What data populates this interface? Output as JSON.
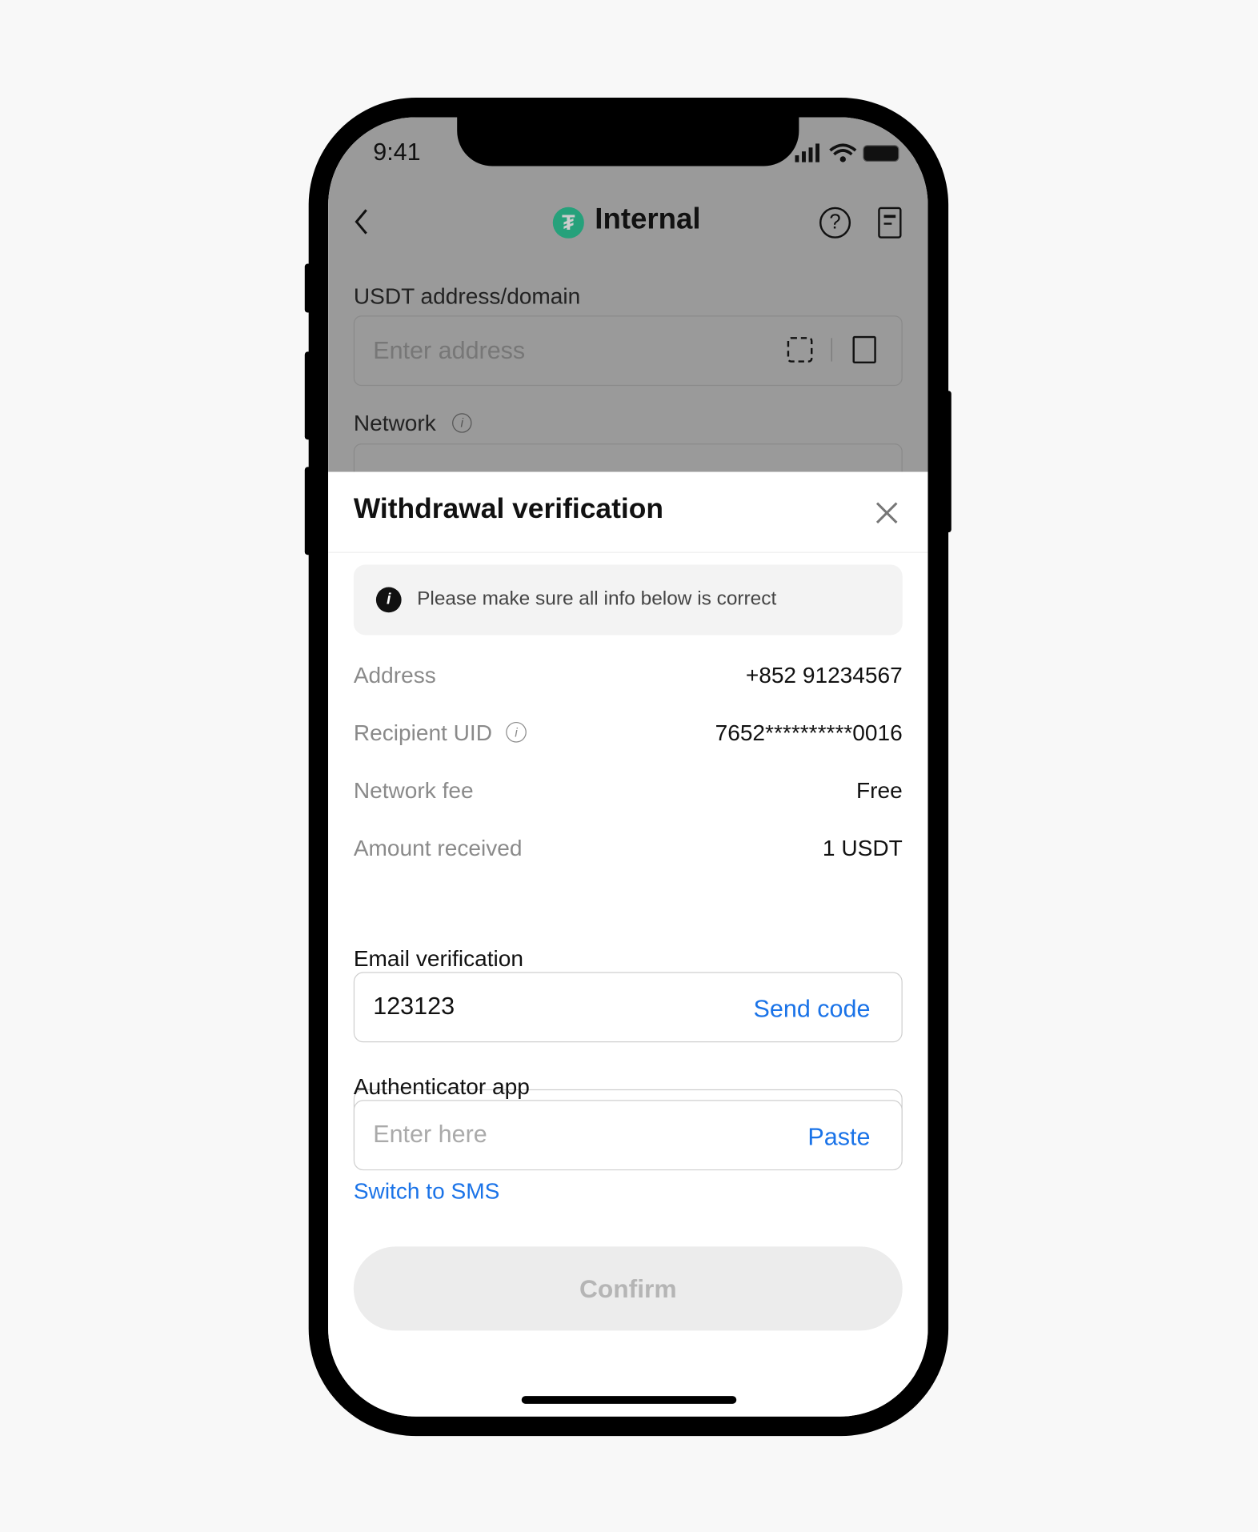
{
  "status_bar": {
    "time": "9:41"
  },
  "header": {
    "title": "Internal",
    "coin_icon": "tether-icon",
    "brand_color": "#26a17b"
  },
  "form": {
    "address_label": "USDT address/domain",
    "address_placeholder": "Enter address",
    "network_label": "Network"
  },
  "sheet": {
    "title": "Withdrawal verification",
    "notice": "Please make sure all info below is correct",
    "rows": [
      {
        "label": "Address",
        "value": "+852 91234567"
      },
      {
        "label": "Recipient UID",
        "value": "7652**********0016"
      },
      {
        "label": "Network fee",
        "value": "Free"
      },
      {
        "label": "Amount received",
        "value": "1 USDT"
      }
    ],
    "email_label": "Email verification",
    "email_value": "123123",
    "send_code": "Send code",
    "auth_label": "Authenticator app",
    "auth_placeholder": "Enter here",
    "paste": "Paste",
    "switch_sms": "Switch to SMS",
    "confirm": "Confirm",
    "link_color": "#1a73e8"
  }
}
